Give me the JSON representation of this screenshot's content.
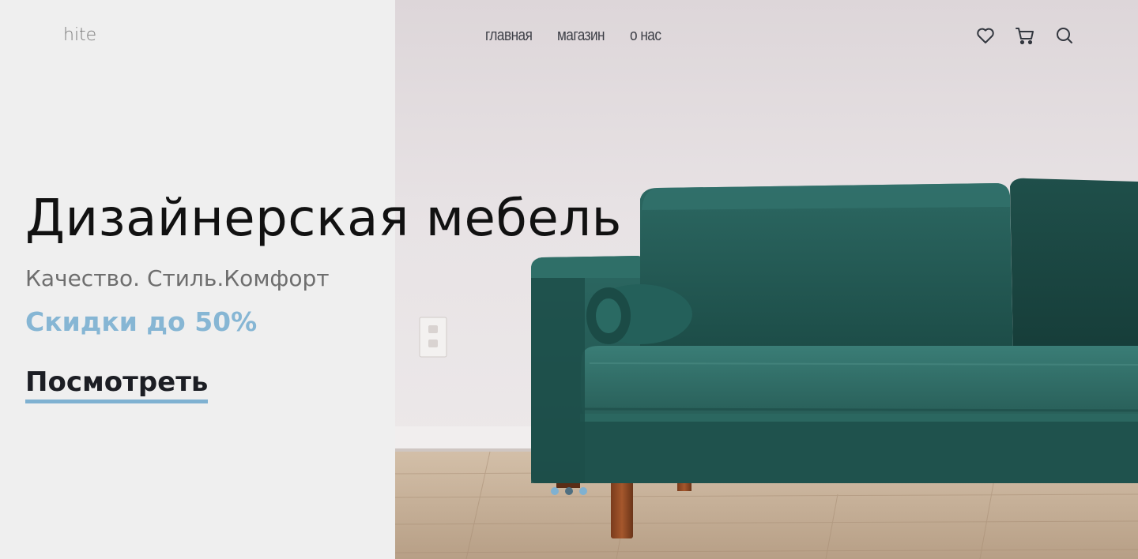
{
  "brand": {
    "logo_text": "hite"
  },
  "nav": {
    "items": [
      {
        "label": "главная"
      },
      {
        "label": "магазин"
      },
      {
        "label": "о нас"
      }
    ]
  },
  "header_icons": [
    "heart-icon",
    "cart-icon",
    "search-icon"
  ],
  "hero": {
    "title": "Дизайнерская мебель",
    "subtitle": "Качество. Стиль.Комфорт",
    "discount": "Скидки до 50%",
    "cta_label": "Посмотреть"
  },
  "slider": {
    "total": 3,
    "active_index": 1
  },
  "colors": {
    "accent": "#7fb1d1",
    "text_dark": "#1c1e24",
    "panel_bg": "#efefef"
  }
}
